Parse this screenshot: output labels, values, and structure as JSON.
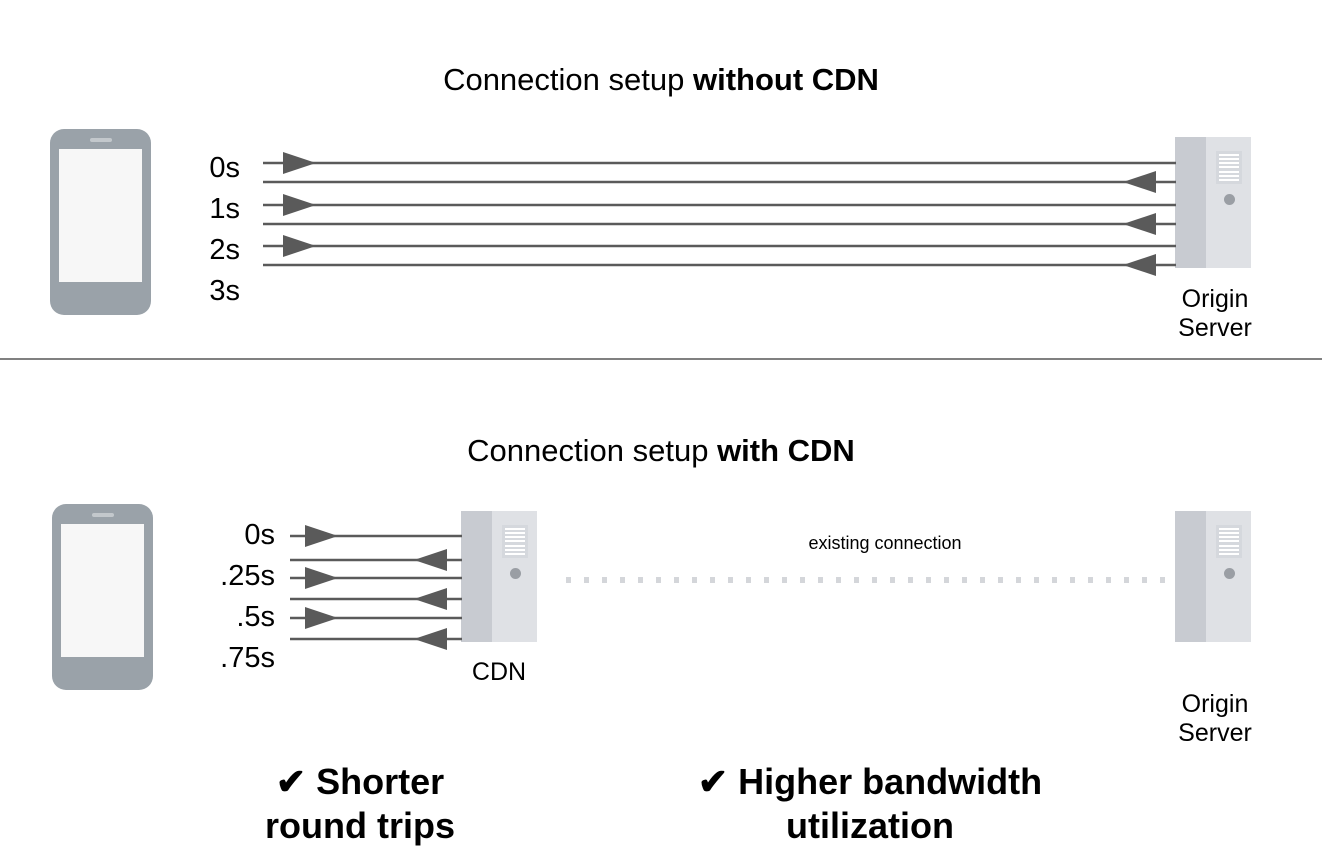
{
  "diagram": {
    "title_top": {
      "prefix": "Connection setup ",
      "emphasis": "without CDN"
    },
    "title_bottom": {
      "prefix": "Connection setup ",
      "emphasis": "with CDN"
    },
    "colors": {
      "arrow": "#5a5a5a",
      "phone_body": "#9aa2a9",
      "phone_screen": "#f7f7f7",
      "server_body": "#dfe1e5",
      "server_panel": "#c8cbd1",
      "server_led": "#9a9ea4",
      "dotted_line": "#d4d6da",
      "divider": "#808080",
      "text": "#000000"
    },
    "top_section": {
      "client_name": "phone",
      "server_caption": "Origin\nServer",
      "time_labels": [
        "0s",
        "1s",
        "2s",
        "3s"
      ],
      "exchanges": [
        {
          "index": 1,
          "direction": "request",
          "from": "phone",
          "to": "origin-server",
          "start_time": "0s"
        },
        {
          "index": 1,
          "direction": "response",
          "from": "origin-server",
          "to": "phone",
          "end_time": "1s"
        },
        {
          "index": 2,
          "direction": "request",
          "from": "phone",
          "to": "origin-server",
          "start_time": "1s"
        },
        {
          "index": 2,
          "direction": "response",
          "from": "origin-server",
          "to": "phone",
          "end_time": "2s"
        },
        {
          "index": 3,
          "direction": "request",
          "from": "phone",
          "to": "origin-server",
          "start_time": "2s"
        },
        {
          "index": 3,
          "direction": "response",
          "from": "origin-server",
          "to": "phone",
          "end_time": "3s"
        }
      ]
    },
    "bottom_section": {
      "client_name": "phone",
      "cdn_caption": "CDN",
      "server_caption": "Origin\nServer",
      "time_labels": [
        "0s",
        ".25s",
        ".5s",
        ".75s"
      ],
      "existing_connection_label": "existing connection",
      "exchanges": [
        {
          "index": 1,
          "direction": "request",
          "from": "phone",
          "to": "cdn",
          "start_time": "0s"
        },
        {
          "index": 1,
          "direction": "response",
          "from": "cdn",
          "to": "phone",
          "end_time": ".25s"
        },
        {
          "index": 2,
          "direction": "request",
          "from": "phone",
          "to": "cdn",
          "start_time": ".25s"
        },
        {
          "index": 2,
          "direction": "response",
          "from": "cdn",
          "to": "phone",
          "end_time": ".5s"
        },
        {
          "index": 3,
          "direction": "request",
          "from": "phone",
          "to": "cdn",
          "start_time": ".5s"
        },
        {
          "index": 3,
          "direction": "response",
          "from": "cdn",
          "to": "phone",
          "end_time": ".75s"
        }
      ]
    },
    "benefits": [
      {
        "icon": "check-icon",
        "glyph": "✔",
        "text": "Shorter\nround trips"
      },
      {
        "icon": "check-icon",
        "glyph": "✔",
        "text": "Higher bandwidth\nutilization"
      }
    ]
  }
}
